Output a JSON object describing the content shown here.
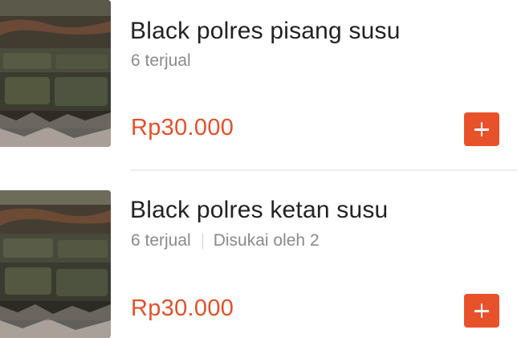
{
  "products": [
    {
      "name": "Black polres pisang susu",
      "sold": "6 terjual",
      "likes": "",
      "price": "Rp30.000",
      "add_icon": "plus-icon"
    },
    {
      "name": "Black polres ketan susu",
      "sold": "6 terjual",
      "likes": "Disukai oleh 2",
      "price": "Rp30.000",
      "add_icon": "plus-icon"
    }
  ],
  "colors": {
    "accent": "#e8522b",
    "price": "#e4502a",
    "title": "#222222",
    "meta": "#8a8a8a",
    "divider": "#ececec"
  }
}
